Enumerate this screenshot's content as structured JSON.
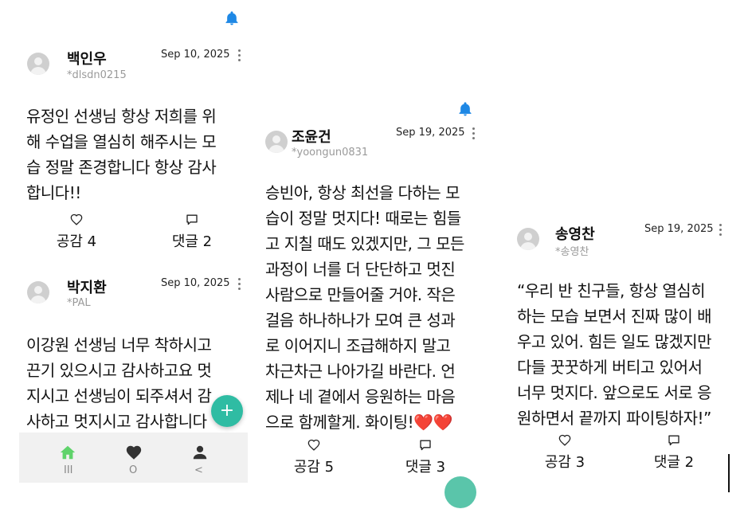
{
  "screens": [
    {
      "posts": [
        {
          "author": "백인우",
          "handle": "*dlsdn0215",
          "date": "Sep 10, 2025",
          "text": "유정인 선생님 항상 저희를 위\n해 수업을 열심히 해주시는 모\n습 정말 존경합니다 항상 감사\n합니다!!",
          "like_label": "공감 4",
          "comment_label": "댓글 2"
        },
        {
          "author": "박지환",
          "handle": "*PAL",
          "date": "Sep 10, 2025",
          "text": "이강원 선생님 너무 착하시고\n끈기 있으시고 감사하고요 멋\n지시고 선생님이 되주셔서 감\n사하고 멋지시고 감사합니다"
        }
      ],
      "fab_label": "+",
      "nav": {
        "items": [
          {
            "icon": "home-icon",
            "color": "#5fd36b"
          },
          {
            "icon": "heart-icon",
            "color": "#333333"
          },
          {
            "icon": "user-icon",
            "color": "#333333"
          }
        ],
        "system": [
          "III",
          "O",
          "<"
        ]
      }
    },
    {
      "posts": [
        {
          "author": "조윤건",
          "handle": "*yoongun0831",
          "date": "Sep 19, 2025",
          "text": "승빈아, 항상 최선을 다하는 모\n습이 정말 멋지다! 때로는 힘들\n고 지칠 때도 있겠지만, 그 모든\n과정이 너를 더 단단하고 멋진\n사람으로 만들어줄 거야. 작은\n걸음 하나하나가 모여 큰 성과\n로 이어지니 조급해하지 말고\n차근차근 나아가길 바란다. 언\n제나 네 곁에서 응원하는 마음\n으로 함께할게. 화이팅!❤️❤️",
          "like_label": "공감 5",
          "comment_label": "댓글 3"
        }
      ]
    },
    {
      "posts": [
        {
          "author": "송영찬",
          "handle": "*송영찬",
          "date": "Sep 19, 2025",
          "text": "“우리 반 친구들, 항상 열심히\n하는 모습 보면서 진짜 많이 배\n우고 있어. 힘든 일도 많겠지만\n다들 꿋꿋하게 버티고 있어서\n너무 멋지다. 앞으로도 서로 응\n원하면서 끝까지 파이팅하자!”",
          "like_label": "공감 3",
          "comment_label": "댓글 2"
        }
      ]
    }
  ],
  "colors": {
    "bell": "#1e88e5",
    "fab": "#2fbca3",
    "nav_active": "#5fd36b"
  }
}
